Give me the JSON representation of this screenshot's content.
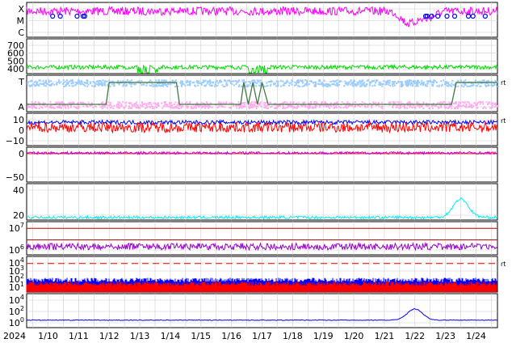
{
  "chart_data": {
    "type": "line",
    "x_axis": {
      "year_label": "2024",
      "tick_labels": [
        "1/10",
        "1/11",
        "1/12",
        "1/13",
        "1/14",
        "1/15",
        "1/16",
        "1/17",
        "1/18",
        "1/19",
        "1/20",
        "1/21",
        "1/22",
        "1/23",
        "1/24"
      ],
      "range_days": [
        9.3,
        24.7
      ]
    },
    "panels": [
      {
        "id": "class",
        "type": "line",
        "yticks": [
          "X",
          "M",
          "C"
        ],
        "series": [
          {
            "color": "#ff00ff",
            "baseline": 0.25,
            "noise": 0.12,
            "peaks": [
              [
                21.8,
                0.6
              ],
              [
                22.4,
                0.45
              ]
            ]
          }
        ],
        "markers": {
          "color": "#0000ff",
          "x": [
            10.15,
            10.4,
            10.95,
            11.15,
            11.2,
            22.35,
            22.4,
            22.55,
            22.75,
            23.05,
            23.3,
            23.75,
            23.9,
            24.3
          ]
        }
      },
      {
        "id": "wind",
        "type": "line",
        "yticks": [
          "700",
          "600",
          "500",
          "400"
        ],
        "ylim": [
          330,
          760
        ],
        "series": [
          {
            "color": "#00dd00",
            "baseline": 410,
            "noise": 25,
            "spikes": [
              [
                12.9,
                13.6
              ],
              [
                16.5,
                17.2
              ]
            ]
          }
        ]
      },
      {
        "id": "sector",
        "type": "scatter",
        "yticks": [
          "T",
          "A"
        ],
        "right_label": "rt",
        "series": [
          {
            "color": "#99ccff",
            "level": 0.2
          },
          {
            "color": "#ffaaee",
            "level": 0.8
          }
        ],
        "step_line": {
          "color": "#447744",
          "x": [
            9.3,
            11.9,
            12.0,
            14.2,
            14.3,
            16.3,
            16.4,
            16.55,
            16.7,
            16.85,
            17.0,
            17.2,
            17.3,
            23.2,
            23.35,
            24.7
          ],
          "y": [
            0.8,
            0.8,
            0.2,
            0.2,
            0.8,
            0.8,
            0.2,
            0.8,
            0.2,
            0.8,
            0.2,
            0.8,
            0.8,
            0.8,
            0.2,
            0.2
          ]
        }
      },
      {
        "id": "bz",
        "type": "line",
        "yticks": [
          "10",
          "0",
          "−10"
        ],
        "ylim": [
          -18,
          14
        ],
        "right_label": "rt",
        "series": [
          {
            "color": "#0000ff",
            "baseline": 5,
            "noise": 2
          },
          {
            "color": "#ff0000",
            "baseline": 0,
            "noise": 5
          }
        ]
      },
      {
        "id": "phi",
        "type": "line",
        "yticks": [
          "0",
          "−50"
        ],
        "ylim": [
          -90,
          20
        ],
        "series": [
          {
            "color": "#cc00cc",
            "baseline": 2,
            "noise": 4
          }
        ],
        "ref_lines": [
          {
            "y": 0,
            "color": "#ff0000"
          }
        ]
      },
      {
        "id": "density",
        "type": "line",
        "yticks": [
          "40",
          "20"
        ],
        "ylim": [
          0,
          55
        ],
        "series": [
          {
            "color": "#00eeee",
            "baseline": 4,
            "noise": 2,
            "peaks": [
              [
                23.5,
                28
              ]
            ]
          }
        ]
      },
      {
        "id": "temp",
        "type": "line",
        "log": true,
        "yticks": [
          "10^7",
          "10^6"
        ],
        "series": [
          {
            "color": "#9900cc",
            "baseline": 0.75,
            "noise": 0.1
          }
        ],
        "ref_lines": [
          {
            "y": 0.2,
            "color": "#cc0000"
          },
          {
            "y": 0.55,
            "color": "#cc0000"
          }
        ]
      },
      {
        "id": "flux",
        "type": "area",
        "log": true,
        "yticks": [
          "10^4",
          "10^3",
          "10^2",
          "10^1"
        ],
        "right_label": "rt",
        "series": [
          {
            "color": "#0000ff",
            "band": [
              0.6,
              1.0
            ]
          },
          {
            "color": "#ff0000",
            "band": [
              0.7,
              1.0
            ]
          }
        ],
        "ref_lines": [
          {
            "y": 0.2,
            "color": "#ff0000",
            "dashed": true
          }
        ]
      },
      {
        "id": "proton",
        "type": "line",
        "log": true,
        "yticks": [
          "10^4",
          "10^2",
          "10^0"
        ],
        "series": [
          {
            "color": "#0000ff",
            "baseline": 0.78,
            "noise": 0.01,
            "peaks": [
              [
                22.0,
                0.45
              ]
            ]
          }
        ]
      }
    ]
  }
}
